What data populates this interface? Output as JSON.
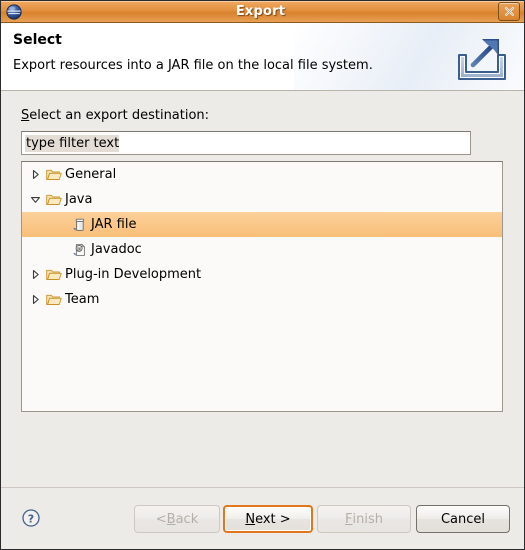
{
  "window": {
    "title": "Export",
    "icon": "eclipse-sphere-icon",
    "close_label": "close-icon"
  },
  "header": {
    "title": "Select",
    "description": "Export resources into a JAR file on the local file system.",
    "icon": "export-arrow-icon"
  },
  "form": {
    "destination_label_prefix": "S",
    "destination_label_rest": "elect an export destination:",
    "filter": {
      "value": "type filter text",
      "placeholder": "type filter text"
    }
  },
  "tree": {
    "items": [
      {
        "label": "General",
        "icon": "folder-icon",
        "state": "collapsed",
        "depth": 0,
        "selected": false
      },
      {
        "label": "Java",
        "icon": "folder-icon",
        "state": "expanded",
        "depth": 0,
        "selected": false
      },
      {
        "label": "JAR file",
        "icon": "jar-icon",
        "state": "leaf",
        "depth": 1,
        "selected": true
      },
      {
        "label": "Javadoc",
        "icon": "javadoc-icon",
        "state": "leaf",
        "depth": 1,
        "selected": false
      },
      {
        "label": "Plug-in Development",
        "icon": "folder-icon",
        "state": "collapsed",
        "depth": 0,
        "selected": false
      },
      {
        "label": "Team",
        "icon": "folder-icon",
        "state": "collapsed",
        "depth": 0,
        "selected": false
      }
    ]
  },
  "footer": {
    "help_icon": "help-question-icon",
    "buttons": {
      "back": {
        "label": "< Back",
        "mnemonic_before": "< ",
        "mnemonic": "B",
        "mnemonic_after": "ack",
        "enabled": false,
        "focused": false
      },
      "next": {
        "label": "Next >",
        "mnemonic_before": "",
        "mnemonic": "N",
        "mnemonic_after": "ext >",
        "enabled": true,
        "focused": true
      },
      "finish": {
        "label": "Finish",
        "mnemonic_before": "",
        "mnemonic": "F",
        "mnemonic_after": "inish",
        "enabled": false,
        "focused": false
      },
      "cancel": {
        "label": "Cancel",
        "mnemonic_before": "",
        "mnemonic": "",
        "mnemonic_after": "Cancel",
        "enabled": true,
        "focused": false
      }
    }
  },
  "colors": {
    "titlebar_orange": "#e2903f",
    "selection_orange": "#f8bf78",
    "focus_ring": "#e2761e",
    "dialog_bg": "#edebe7",
    "field_bg": "#ffffff"
  }
}
